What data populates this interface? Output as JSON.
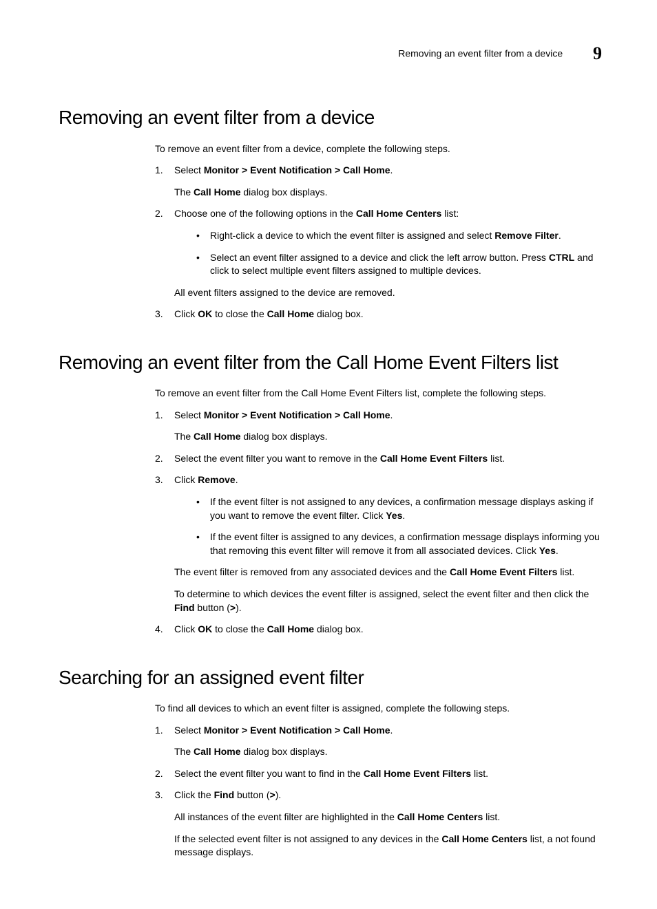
{
  "header": {
    "running_title": "Removing an event filter from a device",
    "chapter_number": "9"
  },
  "sections": [
    {
      "heading": "Removing an event filter from a device",
      "intro": "To remove an event filter from a device, complete the following steps.",
      "steps": [
        {
          "html": "Select <b>Monitor > Event Notification > Call Home</b>.",
          "after": [
            {
              "type": "p",
              "html": "The <b>Call Home</b> dialog box displays."
            }
          ]
        },
        {
          "html": "Choose one of the following options in the <b>Call Home Centers</b> list:",
          "after": [
            {
              "type": "ul",
              "items": [
                "Right-click a device to which the event filter is assigned and select <b>Remove Filter</b>.",
                "Select an event filter assigned to a device and click the left arrow button. Press <b>CTRL</b> and click to select multiple event filters assigned to multiple devices."
              ]
            },
            {
              "type": "p",
              "html": "All event filters assigned to the device are removed."
            }
          ]
        },
        {
          "html": "Click <b>OK</b> to close the <b>Call Home</b> dialog box."
        }
      ]
    },
    {
      "heading": "Removing an event filter from the Call Home Event Filters list",
      "intro": "To remove an event filter from the Call Home Event Filters list, complete the following steps.",
      "steps": [
        {
          "html": "Select <b>Monitor > Event Notification > Call Home</b>.",
          "after": [
            {
              "type": "p",
              "html": "The <b>Call Home</b> dialog box displays."
            }
          ]
        },
        {
          "html": "Select the event filter you want to remove in the <b>Call Home Event Filters</b> list."
        },
        {
          "html": "Click <b>Remove</b>.",
          "after": [
            {
              "type": "ul",
              "items": [
                "If the event filter is not assigned to any devices, a confirmation message displays asking if you want to remove the event filter. Click <b>Yes</b>.",
                "If the event filter is assigned to any devices, a confirmation message displays informing you that removing this event filter will remove it from all associated devices. Click <b>Yes</b>."
              ]
            },
            {
              "type": "p",
              "html": "The event filter is removed from any associated devices and the <b>Call Home Event Filters</b> list."
            },
            {
              "type": "p",
              "html": "To determine to which devices the event filter is assigned, select the event filter and then click the <b>Find</b> button (<b>></b>)."
            }
          ]
        },
        {
          "html": "Click <b>OK</b> to close the <b>Call Home</b> dialog box."
        }
      ]
    },
    {
      "heading": "Searching for an assigned event filter",
      "intro": "To find all devices to which an event filter is assigned, complete the following steps.",
      "steps": [
        {
          "html": "Select <b>Monitor > Event Notification > Call Home</b>.",
          "after": [
            {
              "type": "p",
              "html": "The <b>Call Home</b> dialog box displays."
            }
          ]
        },
        {
          "html": "Select the event filter you want to find in the <b>Call Home Event Filters</b> list."
        },
        {
          "html": "Click the <b>Find</b> button (<b>></b>).",
          "after": [
            {
              "type": "p",
              "html": "All instances of the event filter are highlighted in the <b>Call Home Centers</b> list."
            },
            {
              "type": "p",
              "html": "If the selected event filter is not assigned to any devices in the <b>Call Home Centers</b> list, a not found message displays."
            }
          ]
        }
      ]
    }
  ]
}
